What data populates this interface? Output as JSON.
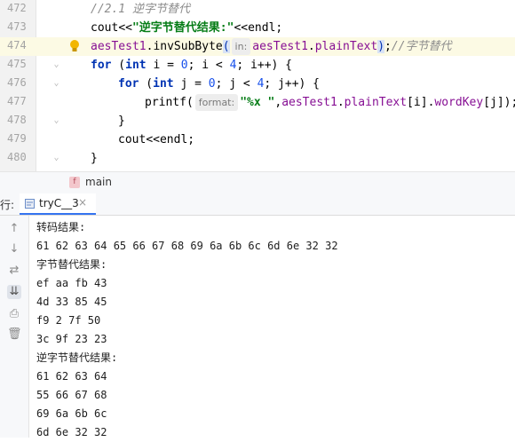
{
  "editor": {
    "lines": [
      {
        "num": "472",
        "tokens": [
          {
            "t": "//2.1 逆字节替代",
            "c": "cm"
          }
        ],
        "indent": 102
      },
      {
        "num": "473",
        "tokens": [
          {
            "t": "cout",
            "c": "id"
          },
          {
            "t": "<<",
            "c": "id"
          },
          {
            "t": "\"逆字节替代结果:\"",
            "c": "str"
          },
          {
            "t": "<<",
            "c": "id"
          },
          {
            "t": "endl",
            "c": "id"
          },
          {
            "t": ";",
            "c": "id"
          }
        ],
        "indent": 102
      },
      {
        "num": "474",
        "tokens": [
          {
            "t": "aesTest1",
            "c": "fld"
          },
          {
            "t": ".invSubByte",
            "c": "id"
          },
          {
            "t": "(",
            "c": "brk"
          },
          {
            "t": "in:",
            "c": "hint"
          },
          {
            "t": "aesTest1",
            "c": "fld"
          },
          {
            "t": ".",
            "c": "id"
          },
          {
            "t": "plainText",
            "c": "fld"
          },
          {
            "t": ")",
            "c": "brk"
          },
          {
            "t": ";",
            "c": "id"
          },
          {
            "t": "//字节替代",
            "c": "cm"
          }
        ],
        "indent": 102
      },
      {
        "num": "475",
        "tokens": [
          {
            "t": "for",
            "c": "kw"
          },
          {
            "t": " (",
            "c": "id"
          },
          {
            "t": "int",
            "c": "kw"
          },
          {
            "t": " i = ",
            "c": "id"
          },
          {
            "t": "0",
            "c": "num"
          },
          {
            "t": "; i < ",
            "c": "id"
          },
          {
            "t": "4",
            "c": "num"
          },
          {
            "t": "; i++) {",
            "c": "id"
          }
        ],
        "indent": 102
      },
      {
        "num": "476",
        "tokens": [
          {
            "t": "for",
            "c": "kw"
          },
          {
            "t": " (",
            "c": "id"
          },
          {
            "t": "int",
            "c": "kw"
          },
          {
            "t": " j = ",
            "c": "id"
          },
          {
            "t": "0",
            "c": "num"
          },
          {
            "t": "; j < ",
            "c": "id"
          },
          {
            "t": "4",
            "c": "num"
          },
          {
            "t": "; j++) {",
            "c": "id"
          }
        ],
        "indent": 133
      },
      {
        "num": "477",
        "tokens": [
          {
            "t": "printf(",
            "c": "id"
          },
          {
            "t": "format:",
            "c": "hint"
          },
          {
            "t": "\"%x \"",
            "c": "str"
          },
          {
            "t": ",",
            "c": "id"
          },
          {
            "t": "aesTest1",
            "c": "fld"
          },
          {
            "t": ".",
            "c": "id"
          },
          {
            "t": "plainText",
            "c": "fld"
          },
          {
            "t": "[i].",
            "c": "id"
          },
          {
            "t": "wordKey",
            "c": "fld"
          },
          {
            "t": "[j]);",
            "c": "id"
          }
        ],
        "indent": 163
      },
      {
        "num": "478",
        "tokens": [
          {
            "t": "}",
            "c": "id"
          }
        ],
        "indent": 133
      },
      {
        "num": "479",
        "tokens": [
          {
            "t": "cout",
            "c": "id"
          },
          {
            "t": "<<",
            "c": "id"
          },
          {
            "t": "endl",
            "c": "id"
          },
          {
            "t": ";",
            "c": "id"
          }
        ],
        "indent": 133
      },
      {
        "num": "480",
        "tokens": [
          {
            "t": "}",
            "c": "id"
          }
        ],
        "indent": 102
      }
    ],
    "highlight_line": "474"
  },
  "breadcrumb": {
    "badge": "f",
    "label": "main"
  },
  "run_tabs": {
    "prefix": "行:",
    "tab_label": "tryC__3",
    "close": "×"
  },
  "toolbar": {
    "buttons": [
      {
        "name": "scroll-up-icon",
        "glyph": "↑"
      },
      {
        "name": "scroll-down-icon",
        "glyph": "↓"
      },
      {
        "name": "soft-wrap-icon",
        "glyph": "⇄"
      },
      {
        "name": "scroll-to-end-icon",
        "glyph": "⇊"
      },
      {
        "name": "print-icon",
        "glyph": "⎙"
      },
      {
        "name": "trash-icon",
        "glyph": "🗑"
      }
    ]
  },
  "console": {
    "lines": [
      "转码结果:",
      "61 62 63 64 65 66 67 68 69 6a 6b 6c 6d 6e 32 32",
      "字节替代结果:",
      "ef aa fb 43",
      "4d 33 85 45",
      "f9 2 7f 50",
      "3c 9f 23 23",
      "逆字节替代结果:",
      "61 62 63 64",
      "55 66 67 68",
      "69 6a 6b 6c",
      "6d 6e 32 32"
    ]
  },
  "colors": {
    "accent": "#3574f0",
    "highlight": "#fcfae4",
    "string": "#067d17",
    "keyword": "#0033b3",
    "field": "#871094"
  }
}
